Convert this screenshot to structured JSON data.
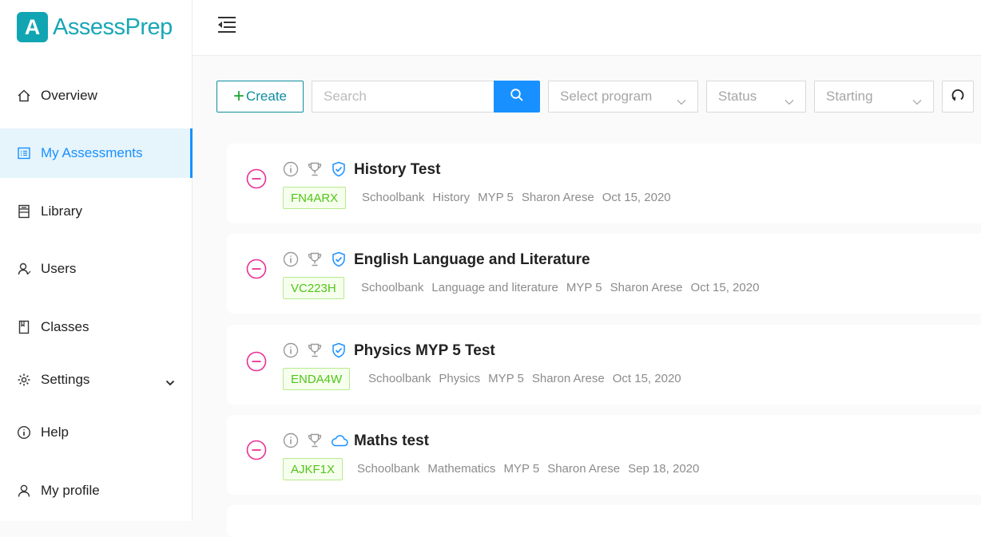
{
  "app": {
    "logo_letter": "A",
    "logo_text": "AssessPrep"
  },
  "sidebar": {
    "items": [
      {
        "label": "Overview",
        "icon": "home-icon"
      },
      {
        "label": "My Assessments",
        "icon": "list-icon"
      },
      {
        "label": "Library",
        "icon": "book-icon"
      },
      {
        "label": "Users",
        "icon": "user-icon"
      },
      {
        "label": "Classes",
        "icon": "bookmark-icon"
      },
      {
        "label": "Settings",
        "icon": "gear-icon"
      },
      {
        "label": "Help",
        "icon": "info-icon"
      },
      {
        "label": "My profile",
        "icon": "profile-icon"
      }
    ]
  },
  "toolbar": {
    "create_label": "Create",
    "search_placeholder": "Search",
    "program_placeholder": "Select program",
    "status_placeholder": "Status",
    "starting_placeholder": "Starting"
  },
  "assessments": [
    {
      "title": "History Test",
      "code": "FN4ARX",
      "bank": "Schoolbank",
      "subject": "History",
      "grade": "MYP 5",
      "author": "Sharon Arese",
      "date": "Oct 15, 2020",
      "status_icon": "shield-check-icon"
    },
    {
      "title": "English Language and Literature",
      "code": "VC223H",
      "bank": "Schoolbank",
      "subject": "Language and literature",
      "grade": "MYP 5",
      "author": "Sharon Arese",
      "date": "Oct 15, 2020",
      "status_icon": "shield-check-icon"
    },
    {
      "title": "Physics MYP 5 Test",
      "code": "ENDA4W",
      "bank": "Schoolbank",
      "subject": "Physics",
      "grade": "MYP 5",
      "author": "Sharon Arese",
      "date": "Oct 15, 2020",
      "status_icon": "shield-check-icon"
    },
    {
      "title": "Maths test",
      "code": "AJKF1X",
      "bank": "Schoolbank",
      "subject": "Mathematics",
      "grade": "MYP 5",
      "author": "Sharon Arese",
      "date": "Sep 18, 2020",
      "status_icon": "cloud-icon"
    }
  ],
  "colors": {
    "accent": "#1890ff",
    "brand": "#11a5b3",
    "remove": "#eb2f96",
    "code_green": "#52c41a"
  }
}
